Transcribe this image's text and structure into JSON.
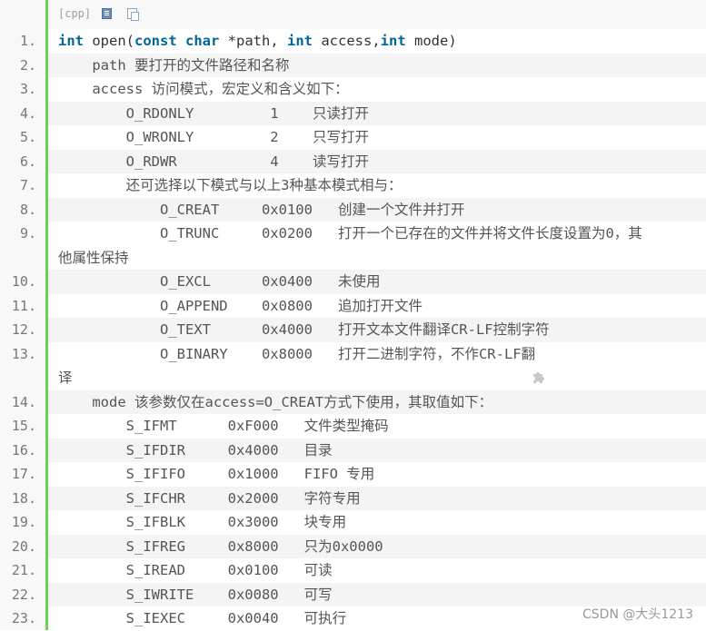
{
  "toolbar": {
    "language": "[cpp]",
    "view_icon": "view-plain-icon",
    "copy_icon": "copy-icon"
  },
  "lines": [
    {
      "n": "1.",
      "keyword_line": true
    },
    {
      "n": "2.",
      "text": "    path 要打开的文件路径和名称"
    },
    {
      "n": "3.",
      "text": "    access 访问模式，宏定义和含义如下："
    },
    {
      "n": "4.",
      "text": "        O_RDONLY         1    只读打开"
    },
    {
      "n": "5.",
      "text": "        O_WRONLY         2    只写打开"
    },
    {
      "n": "6.",
      "text": "        O_RDWR           4    读写打开"
    },
    {
      "n": "7.",
      "text": "        还可选择以下模式与以上3种基本模式相与："
    },
    {
      "n": "8.",
      "text": "            O_CREAT     0x0100   创建一个文件并打开"
    },
    {
      "n": "9.",
      "text": "            O_TRUNC     0x0200   打开一个已存在的文件并将文件长度设置为0，其",
      "cont": "他属性保持"
    },
    {
      "n": "10.",
      "text": "            O_EXCL      0x0400   未使用"
    },
    {
      "n": "11.",
      "text": "            O_APPEND    0x0800   追加打开文件"
    },
    {
      "n": "12.",
      "text": "            O_TEXT      0x4000   打开文本文件翻译CR-LF控制字符"
    },
    {
      "n": "13.",
      "text": "            O_BINARY    0x8000   打开二进制字符，不作CR-LF翻",
      "cont": "译"
    },
    {
      "n": "14.",
      "text": "    mode 该参数仅在access=O_CREAT方式下使用，其取值如下："
    },
    {
      "n": "15.",
      "text": "        S_IFMT      0xF000   文件类型掩码"
    },
    {
      "n": "16.",
      "text": "        S_IFDIR     0x4000   目录"
    },
    {
      "n": "17.",
      "text": "        S_IFIFO     0x1000   FIFO 专用"
    },
    {
      "n": "18.",
      "text": "        S_IFCHR     0x2000   字符专用"
    },
    {
      "n": "19.",
      "text": "        S_IFBLK     0x3000   块专用"
    },
    {
      "n": "20.",
      "text": "        S_IFREG     0x8000   只为0x0000"
    },
    {
      "n": "21.",
      "text": "        S_IREAD     0x0100   可读"
    },
    {
      "n": "22.",
      "text": "        S_IWRITE    0x0080   可写"
    },
    {
      "n": "23.",
      "text": "        S_IEXEC     0x0040   可执行"
    }
  ],
  "line1": {
    "kw_int1": "int",
    "t1": " open(",
    "kw_const": "const",
    "t2": " ",
    "kw_char": "char",
    "t3": " *path, ",
    "kw_int2": "int",
    "t4": " access,",
    "kw_int3": "int",
    "t5": " mode)"
  },
  "watermark": "CSDN @大头1213",
  "colors": {
    "gutter_rule": "#6ccf59",
    "keyword": "#006699",
    "line_number": "#777777",
    "text": "#555555"
  }
}
